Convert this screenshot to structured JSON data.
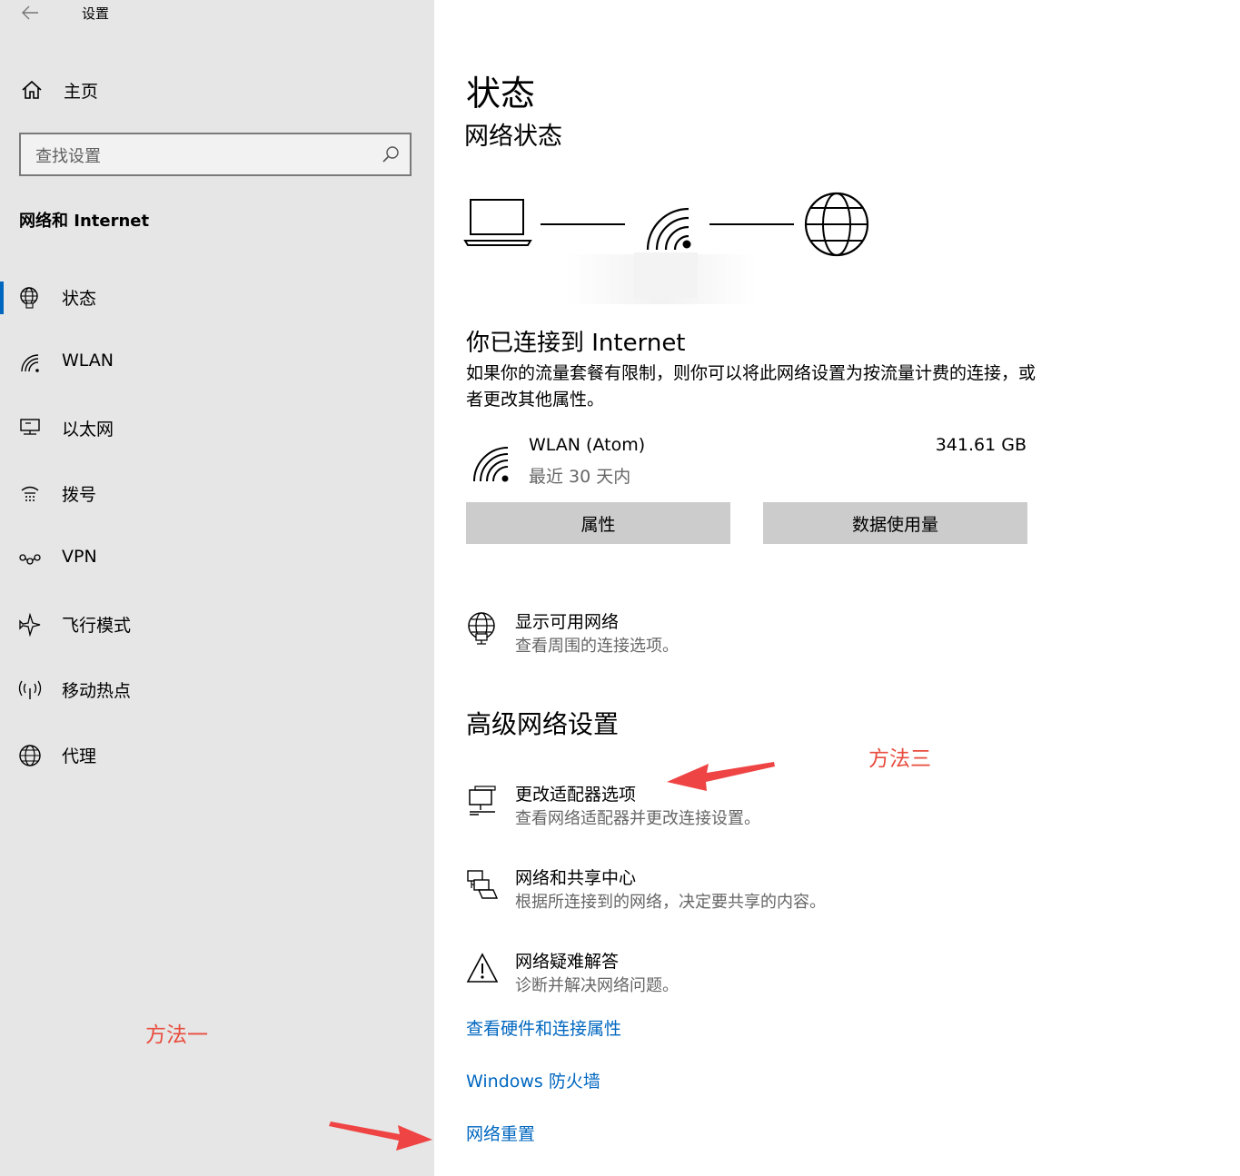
{
  "window": {
    "title": "设置"
  },
  "sidebar": {
    "home_label": "主页",
    "search_placeholder": "查找设置",
    "section": "网络和 Internet",
    "items": [
      {
        "label": "状态",
        "icon": "globe-status-icon",
        "active": true
      },
      {
        "label": "WLAN",
        "icon": "wifi-icon"
      },
      {
        "label": "以太网",
        "icon": "ethernet-icon"
      },
      {
        "label": "拨号",
        "icon": "dialup-icon"
      },
      {
        "label": "VPN",
        "icon": "vpn-icon"
      },
      {
        "label": "飞行模式",
        "icon": "airplane-icon"
      },
      {
        "label": "移动热点",
        "icon": "hotspot-icon"
      },
      {
        "label": "代理",
        "icon": "globe-icon"
      }
    ]
  },
  "annotations": {
    "method1": "方法一",
    "method3": "方法三",
    "color": "#e84c3d"
  },
  "main": {
    "title": "状态",
    "subtitle": "网络状态",
    "connected_title": "你已连接到 Internet",
    "connected_desc": "如果你的流量套餐有限制，则你可以将此网络设置为按流量计费的连接，或者更改其他属性。",
    "connection": {
      "name": "WLAN (Atom)",
      "period": "最近 30 天内",
      "usage": "341.61 GB"
    },
    "buttons": {
      "properties": "属性",
      "data_usage": "数据使用量"
    },
    "show_networks": {
      "title": "显示可用网络",
      "desc": "查看周围的连接选项。"
    },
    "advanced_title": "高级网络设置",
    "advanced": [
      {
        "title": "更改适配器选项",
        "desc": "查看网络适配器并更改连接设置。"
      },
      {
        "title": "网络和共享中心",
        "desc": "根据所连接到的网络，决定要共享的内容。"
      },
      {
        "title": "网络疑难解答",
        "desc": "诊断并解决网络问题。"
      }
    ],
    "links": [
      "查看硬件和连接属性",
      "Windows 防火墙",
      "网络重置"
    ]
  },
  "colors": {
    "accent": "#0067c0",
    "sidebar_bg": "#e6e6e6",
    "button_bg": "#cccccc"
  }
}
